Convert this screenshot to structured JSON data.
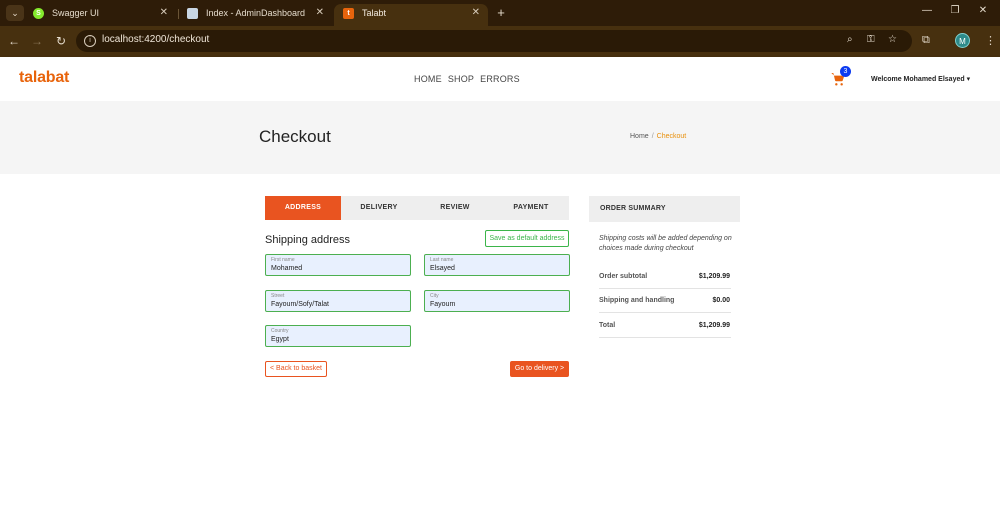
{
  "browser": {
    "tabs": [
      {
        "title": "Swagger UI",
        "favicon": "S",
        "favicon_color": "#85ea2d"
      },
      {
        "title": "Index - AdminDashboard",
        "favicon": "",
        "favicon_color": "#c9d6e3"
      },
      {
        "title": "Talabt",
        "favicon": "t",
        "favicon_color": "#e8640c"
      }
    ],
    "url": "localhost:4200/checkout",
    "profile_initial": "M"
  },
  "navbar": {
    "logo": "talabat",
    "links": [
      "HOME",
      "SHOP",
      "ERRORS"
    ],
    "cart_count": "3",
    "welcome": "Welcome Mohamed Elsayed ▾"
  },
  "header": {
    "title": "Checkout",
    "breadcrumb": [
      "Home",
      "Checkout"
    ]
  },
  "stepper": [
    "ADDRESS",
    "DELIVERY",
    "REVIEW",
    "PAYMENT"
  ],
  "address_form": {
    "title": "Shipping address",
    "save_default_label": "Save as default address",
    "fields": {
      "first_name": {
        "label": "First name",
        "value": "Mohamed"
      },
      "last_name": {
        "label": "Last name",
        "value": "Elsayed"
      },
      "street": {
        "label": "Street",
        "value": "Fayoum/Sofy/Talat"
      },
      "city": {
        "label": "City",
        "value": "Fayoum"
      },
      "country": {
        "label": "Country",
        "value": "Egypt"
      }
    },
    "back_label": "< Back to basket",
    "next_label": "Go to delivery >"
  },
  "summary": {
    "title": "ORDER SUMMARY",
    "note": "Shipping costs will be added depending on choices made during checkout",
    "rows": [
      {
        "label": "Order subtotal",
        "value": "$1,209.99"
      },
      {
        "label": "Shipping and handling",
        "value": "$0.00"
      },
      {
        "label": "Total",
        "value": "$1,209.99"
      }
    ]
  },
  "colors": {
    "brand": "#e8640c",
    "accent": "#e95420",
    "success": "#3bb54a",
    "badge": "#0d3bf0"
  }
}
